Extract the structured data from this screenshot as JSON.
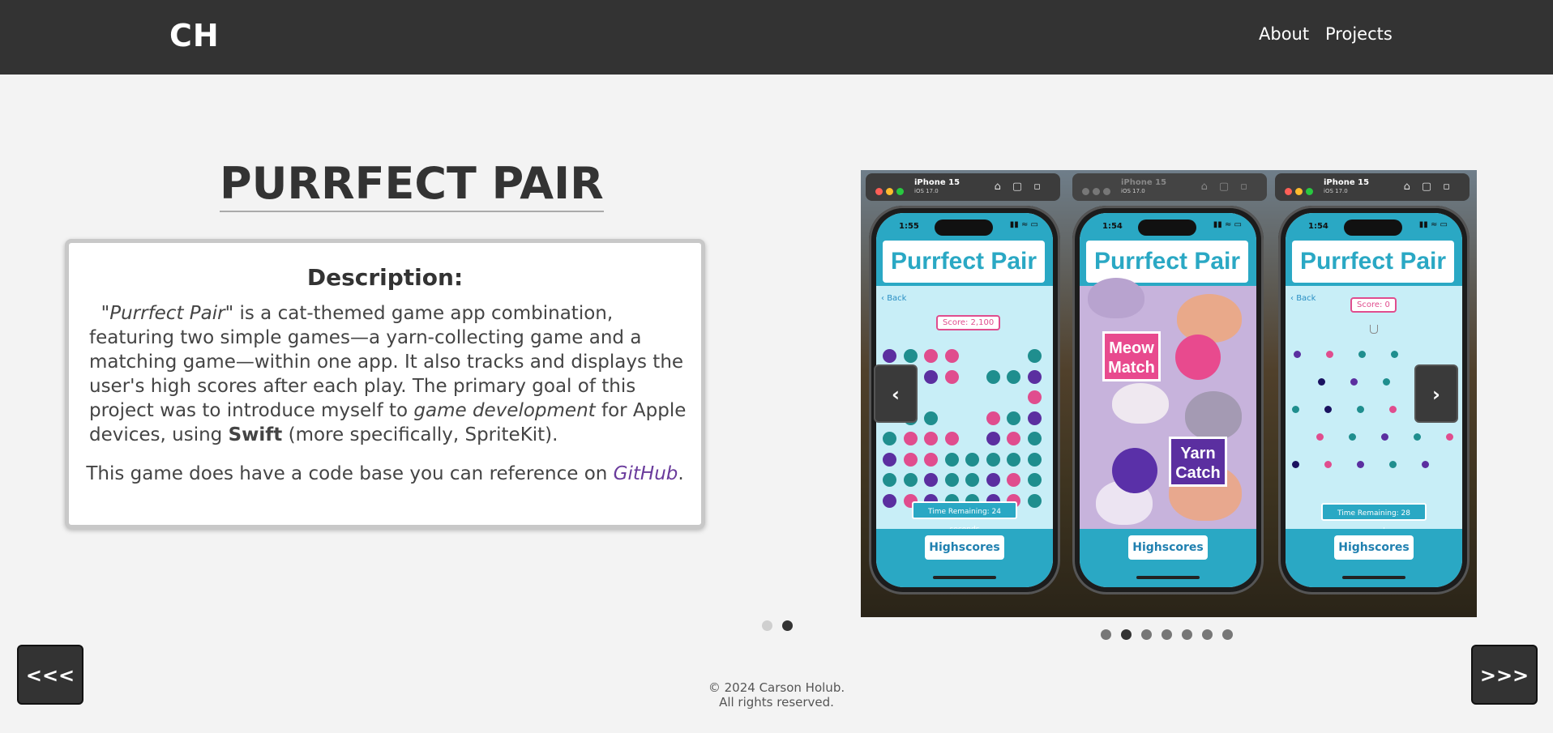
{
  "header": {
    "logo": "CH",
    "nav": [
      "About",
      "Projects"
    ]
  },
  "project": {
    "title": "PURRFECT PAIR",
    "description_heading": "Description:",
    "description": {
      "title_quote": "\"Purrfect Pair\"",
      "part1": " is a cat-themed game app combination, featuring two simple games—a yarn-collecting game and a matching game—within one app. It also tracks and displays the user's high scores after each play. The primary goal of this project was to introduce myself to ",
      "emphasis": "game development",
      "part2": " for Apple devices, using ",
      "strong": "Swift",
      "part3": " (more specifically, SpriteKit)."
    },
    "code_note": {
      "prefix": "This game does have a code base you can reference on ",
      "link": "GitHub",
      "suffix": "."
    }
  },
  "gallery": {
    "screens": [
      {
        "device": "iPhone 15",
        "os": "iOS 17.0",
        "time": "1:55",
        "app_title": "Purrfect Pair",
        "back": "Back",
        "score": "Score: 2,100",
        "time_remaining": "Time Remaining: 24 seconds",
        "button": "Highscores"
      },
      {
        "device": "iPhone 15",
        "os": "iOS 17.0",
        "time": "1:54",
        "app_title": "Purrfect Pair",
        "game1": "Meow Match",
        "game2": "Yarn Catch",
        "button": "Highscores"
      },
      {
        "device": "iPhone 15",
        "os": "iOS 17.0",
        "time": "1:54",
        "app_title": "Purrfect Pair",
        "back": "Back",
        "score": "Score: 0",
        "time_remaining": "Time Remaining: 28 seconds",
        "button": "Highscores"
      }
    ],
    "prev": "‹",
    "next": "›",
    "dots_count": 7,
    "active_dot": 1
  },
  "section_dots": {
    "count": 2,
    "active": 1
  },
  "pager": {
    "prev": "<<<",
    "next": ">>>"
  },
  "footer": {
    "copyright": "© 2024 Carson Holub.",
    "rights": "All rights reserved."
  },
  "colors": {
    "header": "#333333",
    "accent": "#2aa8c4",
    "link": "#6a3b9c",
    "pink": "#e04d8e",
    "teal": "#1f8e8e",
    "purple": "#5b2fa0"
  }
}
